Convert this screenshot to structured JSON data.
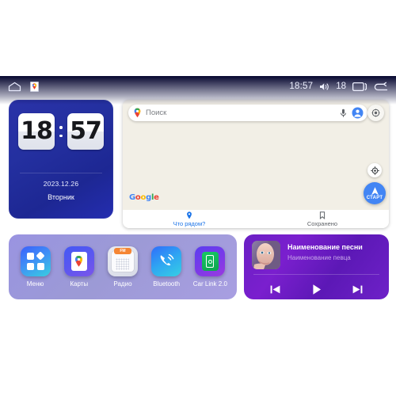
{
  "statusbar": {
    "home_icon": "home-icon",
    "notification_icon": "google-maps-notification-icon",
    "time": "18:57",
    "volume_icon": "speaker-icon",
    "volume_level": "18",
    "recents_icon": "recent-apps-icon",
    "back_icon": "back-arrow-icon"
  },
  "clock_widget": {
    "hours": "18",
    "minutes": "57",
    "date": "2023.12.26",
    "weekday": "Вторник"
  },
  "map_widget": {
    "search": {
      "placeholder": "Поиск",
      "pin_icon": "google-maps-pin-icon",
      "mic_icon": "microphone-icon",
      "avatar_icon": "account-avatar-icon"
    },
    "layers_icon": "layers-button-icon",
    "locate_icon": "my-location-icon",
    "start_button_label": "СТАРТ",
    "start_button_icon": "navigation-arrow-icon",
    "attribution": "Google",
    "tabs": [
      {
        "label": "Что рядом?",
        "icon": "pin-icon",
        "active": true
      },
      {
        "label": "Сохранено",
        "icon": "bookmark-icon",
        "active": false
      }
    ]
  },
  "apps": [
    {
      "label": "Меню",
      "icon": "menu-grid-icon"
    },
    {
      "label": "Карты",
      "icon": "maps-icon"
    },
    {
      "label": "Радио",
      "icon": "radio-icon",
      "badge": "FM"
    },
    {
      "label": "Bluetooth",
      "icon": "bluetooth-phone-icon"
    },
    {
      "label": "Car Link 2.0",
      "icon": "car-link-icon"
    }
  ],
  "music_widget": {
    "title": "Наименование песни",
    "artist": "Наименование певца",
    "album_art_icon": "album-art-portrait",
    "controls": [
      {
        "name": "previous-track-button",
        "icon": "skip-previous-icon"
      },
      {
        "name": "play-button",
        "icon": "play-icon"
      },
      {
        "name": "next-track-button",
        "icon": "skip-next-icon"
      }
    ]
  },
  "colors": {
    "accent_blue": "#1a73e8",
    "map_bg": "#f2efe6",
    "music_purple": "#6a1fc4",
    "screen_navy": "#11135e"
  }
}
